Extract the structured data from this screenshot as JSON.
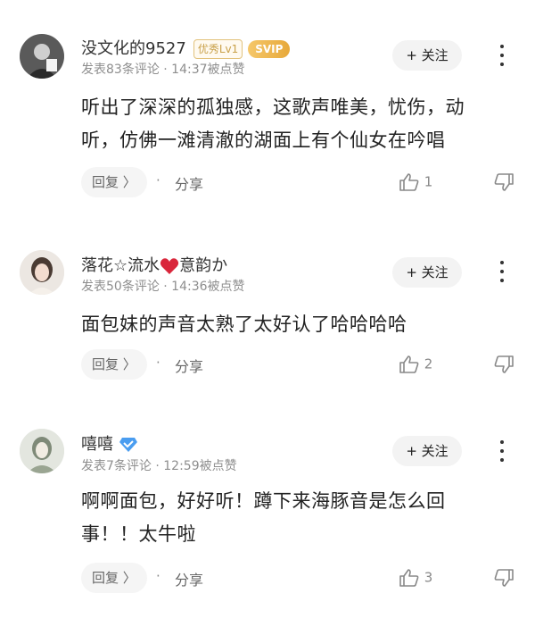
{
  "follow_label": "+ 关注",
  "comments": [
    {
      "username": "没文化的9527",
      "level_badge": "优秀Lv1",
      "svip_badge": "SVIP",
      "meta": "发表83条评论 · 14:37被点赞",
      "content_lines": [
        "听出了深深的孤独感，这歌声唯美，忧伤，动",
        "听，仿佛一滩清澈的湖面上有个仙女在吟唱"
      ],
      "reply_label": "回复 〉",
      "share_label": "分享",
      "likes": "1"
    },
    {
      "username": "落花☆流水",
      "username_suffix": "意韵か",
      "meta": "发表50条评论 · 14:36被点赞",
      "content_lines": [
        "面包妹的声音太熟了太好认了哈哈哈哈"
      ],
      "reply_label": "回复 〉",
      "share_label": "分享",
      "likes": "2"
    },
    {
      "username": "嘻嘻",
      "meta": "发表7条评论 · 12:59被点赞",
      "content_lines": [
        "啊啊面包，好好听！蹲下来海豚音是怎么回",
        "事！！太牛啦"
      ],
      "reply_label": "回复 〉",
      "share_label": "分享",
      "likes": "3"
    }
  ],
  "colors": {
    "heart": "#d9263b",
    "verified": "#4a9df0",
    "svip": "#e7a93b"
  }
}
